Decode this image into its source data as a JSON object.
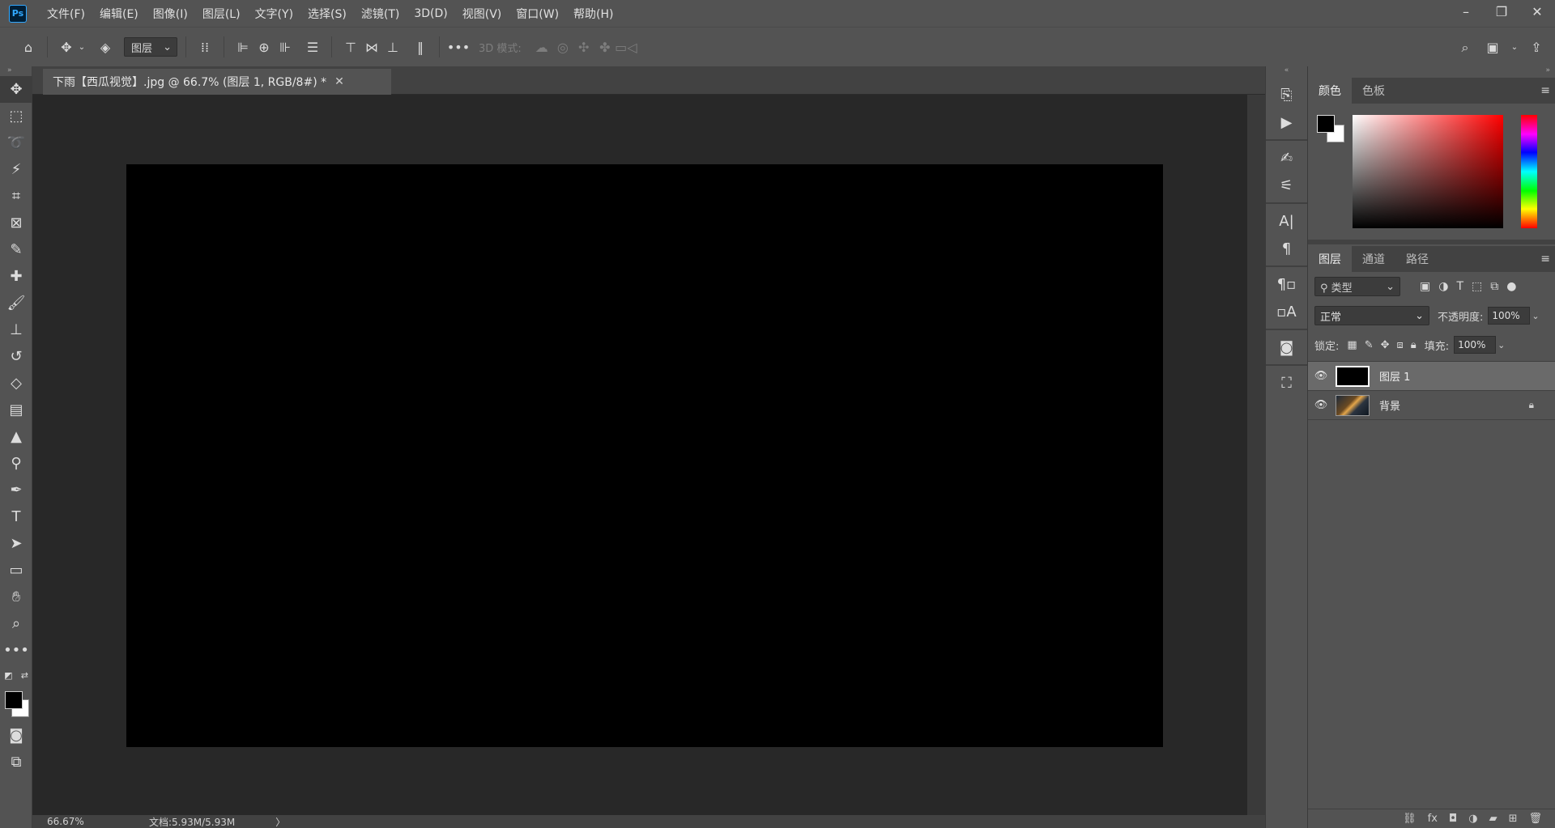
{
  "app": {
    "logo": "Ps",
    "title": "Adobe Photoshop"
  },
  "menu": [
    "文件(F)",
    "编辑(E)",
    "图像(I)",
    "图层(L)",
    "文字(Y)",
    "选择(S)",
    "滤镜(T)",
    "3D(D)",
    "视图(V)",
    "窗口(W)",
    "帮助(H)"
  ],
  "window_controls": {
    "minimize": "–",
    "restore": "❐",
    "close": "✕"
  },
  "options": {
    "auto_select_value": "图层",
    "mode_3d_label": "3D 模式:",
    "more": "•••"
  },
  "document": {
    "tab_title": "下雨【西瓜视觉】.jpg @ 66.7% (图层 1, RGB/8#) *",
    "close": "✕",
    "canvas_color": "#000000"
  },
  "status": {
    "zoom": "66.67%",
    "doc_info": "文档:5.93M/5.93M",
    "arrow": "〉"
  },
  "color_panel": {
    "tabs": [
      "颜色",
      "色板"
    ],
    "fg": "#000000",
    "bg": "#ffffff"
  },
  "layers_panel": {
    "tabs": [
      "图层",
      "通道",
      "路径"
    ],
    "filter": "类型",
    "blend_mode": "正常",
    "opacity_label": "不透明度:",
    "opacity_value": "100%",
    "lock_label": "锁定:",
    "fill_label": "填充:",
    "fill_value": "100%",
    "layers": [
      {
        "name": "图层 1",
        "selected": true,
        "locked": false
      },
      {
        "name": "背景",
        "selected": false,
        "locked": true
      }
    ]
  }
}
